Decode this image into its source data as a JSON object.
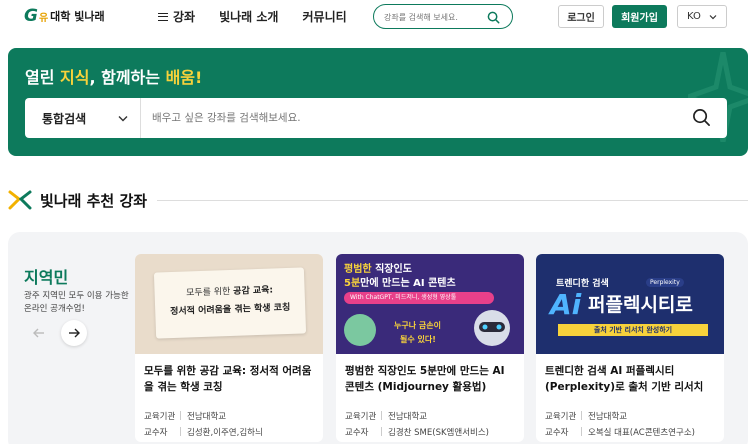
{
  "header": {
    "logo": {
      "mark": "G",
      "small": "유",
      "text": "대학 빛나래"
    },
    "nav": [
      {
        "label": "강좌"
      },
      {
        "label": "빛나래 소개"
      },
      {
        "label": "커뮤니티"
      }
    ],
    "search_placeholder": "강좌를 검색해 보세요.",
    "login_label": "로그인",
    "join_label": "회원가입",
    "language": "KO"
  },
  "hero": {
    "title_a": "열린 ",
    "title_b": "지식",
    "title_c": ", 함께하는 ",
    "title_d": "배움!",
    "search_scope": "통합검색",
    "search_placeholder": "배우고 싶은 강좌를 검색해보세요."
  },
  "section": {
    "title": "빛나래 추천 강좌"
  },
  "panel": {
    "title": "지역민",
    "desc": "광주 지역민 모두 이용 가능한 온라인 공개수업!",
    "cards": [
      {
        "title": "모두를 위한 공감 교육: 정서적 어려움을 겪는 학생 코칭",
        "org_key": "교육기관",
        "org": "전남대학교",
        "prof_key": "교수자",
        "prof": "김성환,이주연,김하늬",
        "thumb_l1a": "모두를 위한 ",
        "thumb_l1b": "공감 교육:",
        "thumb_l2": "정서적 어려움을 겪는 학생 코칭"
      },
      {
        "title": "평범한 직장인도 5분만에 만드는 AI 콘텐츠 (Midjourney 활용법)",
        "org_key": "교육기관",
        "org": "전남대학교",
        "prof_key": "교수자",
        "prof": "김경찬 SME(SK엠앤서비스)",
        "thumb_l1a": "평범한 ",
        "thumb_l1b": "직장인도",
        "thumb_l2a": "5분",
        "thumb_l2b": "만에 만드는 AI 콘텐츠",
        "thumb_bar": "With ChatGPT, 미드저니, 생성형 영상툴",
        "thumb_l3": "누구나 금손이",
        "thumb_l4": "될수 있다!"
      },
      {
        "title": "트렌디한 검색 AI 퍼플렉시티(Perplexity)로 출처 기반 리서치 ...",
        "org_key": "교육기관",
        "org": "전남대학교",
        "prof_key": "교수자",
        "prof": "오복실 대표(AC콘텐츠연구소)",
        "thumb_l1": "트렌디한 검색",
        "thumb_tag": "Perplexity",
        "thumb_ai": "Ai",
        "thumb_big": "퍼플렉시티로",
        "thumb_l3": "출처 기반 리서치 완성하기"
      }
    ]
  },
  "colors": {
    "brand": "#0d7a5c",
    "highlight": "#f7d23b"
  }
}
